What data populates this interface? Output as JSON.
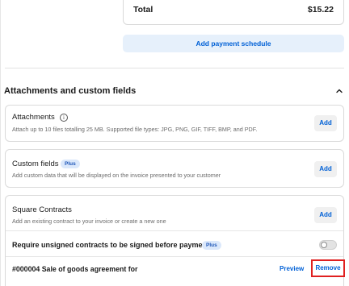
{
  "summary": {
    "total_label": "Total",
    "total_value": "$15.22",
    "payment_schedule_label": "Add payment schedule"
  },
  "section": {
    "title": "Attachments and custom fields",
    "collapse_icon": "chevron-up-icon"
  },
  "attachments": {
    "title": "Attachments",
    "info_icon": "info-icon",
    "description": "Attach up to 10 files totalling 25 MB. Supported file types: JPG, PNG, GIF, TIFF, BMP, and PDF.",
    "add_label": "Add"
  },
  "custom_fields": {
    "title": "Custom fields",
    "badge": "Plus",
    "description": "Add custom data that will be displayed on the invoice presented to your customer",
    "add_label": "Add"
  },
  "contracts": {
    "title": "Square Contracts",
    "description": "Add an existing contract to your invoice or create a new one",
    "add_label": "Add",
    "require_label": "Require unsigned contracts to be signed before payment",
    "require_badge": "Plus",
    "require_toggle_on": false,
    "contract_name": "#000004 Sale of goods agreement for",
    "preview_label": "Preview",
    "remove_label": "Remove"
  }
}
